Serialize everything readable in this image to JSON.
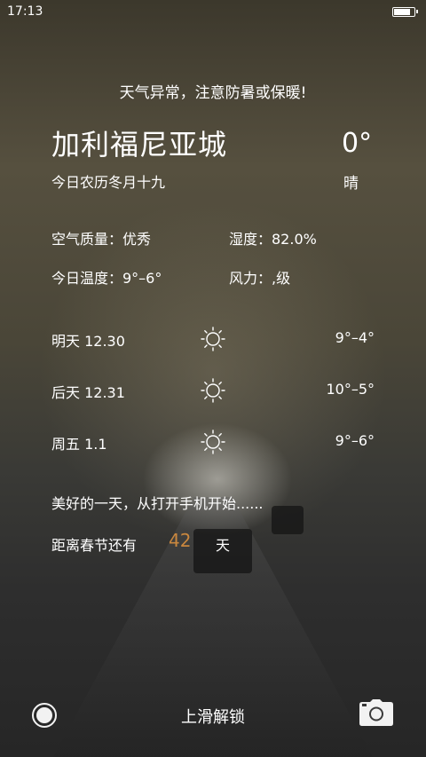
{
  "status_bar": {
    "time": "17:13",
    "battery_level": 0.9
  },
  "weather": {
    "warning": "天气异常，注意防暑或保暖!",
    "city": "加利福尼亚城",
    "current_temp": "0°",
    "lunar_date": "今日农历冬月十九",
    "condition": "晴",
    "air_quality": "空气质量：优秀",
    "humidity": "湿度：82.0%",
    "today_temp": "今日温度：9°–6°",
    "wind": "风力：,级"
  },
  "forecast": [
    {
      "label": "明天 12.30",
      "icon": "sun-icon",
      "temp": "9°–4°"
    },
    {
      "label": "后天 12.31",
      "icon": "sun-icon",
      "temp": "10°–5°"
    },
    {
      "label": "周五 1.1",
      "icon": "sun-icon",
      "temp": "9°–6°"
    }
  ],
  "slogan": "美好的一天，从打开手机开始......",
  "countdown": {
    "label": "距离春节还有",
    "days": "42",
    "unit": "天"
  },
  "bottom_bar": {
    "unlock_text": "上滑解锁",
    "left_icon": "circle-button-icon",
    "right_icon": "camera-icon"
  },
  "colors": {
    "accent_days": "#c9873e",
    "text": "#ffffff"
  }
}
